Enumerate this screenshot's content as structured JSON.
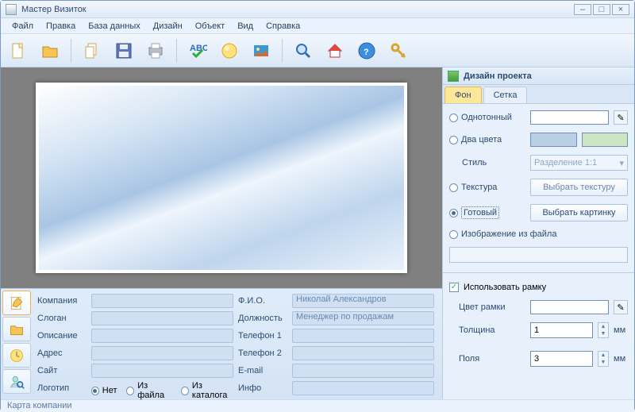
{
  "window": {
    "title": "Мастер Визиток"
  },
  "menu": {
    "file": "Файл",
    "edit": "Правка",
    "db": "База данных",
    "design": "Дизайн",
    "object": "Объект",
    "view": "Вид",
    "help": "Справка"
  },
  "fields": {
    "left": {
      "company": "Компания",
      "slogan": "Слоган",
      "desc": "Описание",
      "address": "Адрес",
      "site": "Сайт",
      "logo": "Логотип"
    },
    "right": {
      "fio": "Ф.И.О.",
      "position": "Должность",
      "phone1": "Телефон 1",
      "phone2": "Телефон 2",
      "email": "E-mail",
      "info": "Инфо"
    },
    "values": {
      "fio": "Николай Александров",
      "position": "Менеджер по продажам"
    },
    "logo_opts": {
      "none": "Нет",
      "fromfile": "Из файла",
      "fromcatalog": "Из каталога"
    }
  },
  "right_panel": {
    "title": "Дизайн проекта",
    "tab_bg": "Фон",
    "tab_grid": "Сетка",
    "solid": "Однотонный",
    "twocolor": "Два цвета",
    "style": "Стиль",
    "style_value": "Разделение 1:1",
    "texture": "Текстура",
    "choose_texture": "Выбрать текстуру",
    "ready": "Готовый",
    "choose_image": "Выбрать картинку",
    "fromfile": "Изображение из файла",
    "use_frame": "Использовать рамку",
    "frame_color": "Цвет рамки",
    "thickness": "Толщина",
    "thickness_val": "1",
    "margins": "Поля",
    "margins_val": "3",
    "unit": "мм"
  },
  "status": "Карта компании"
}
